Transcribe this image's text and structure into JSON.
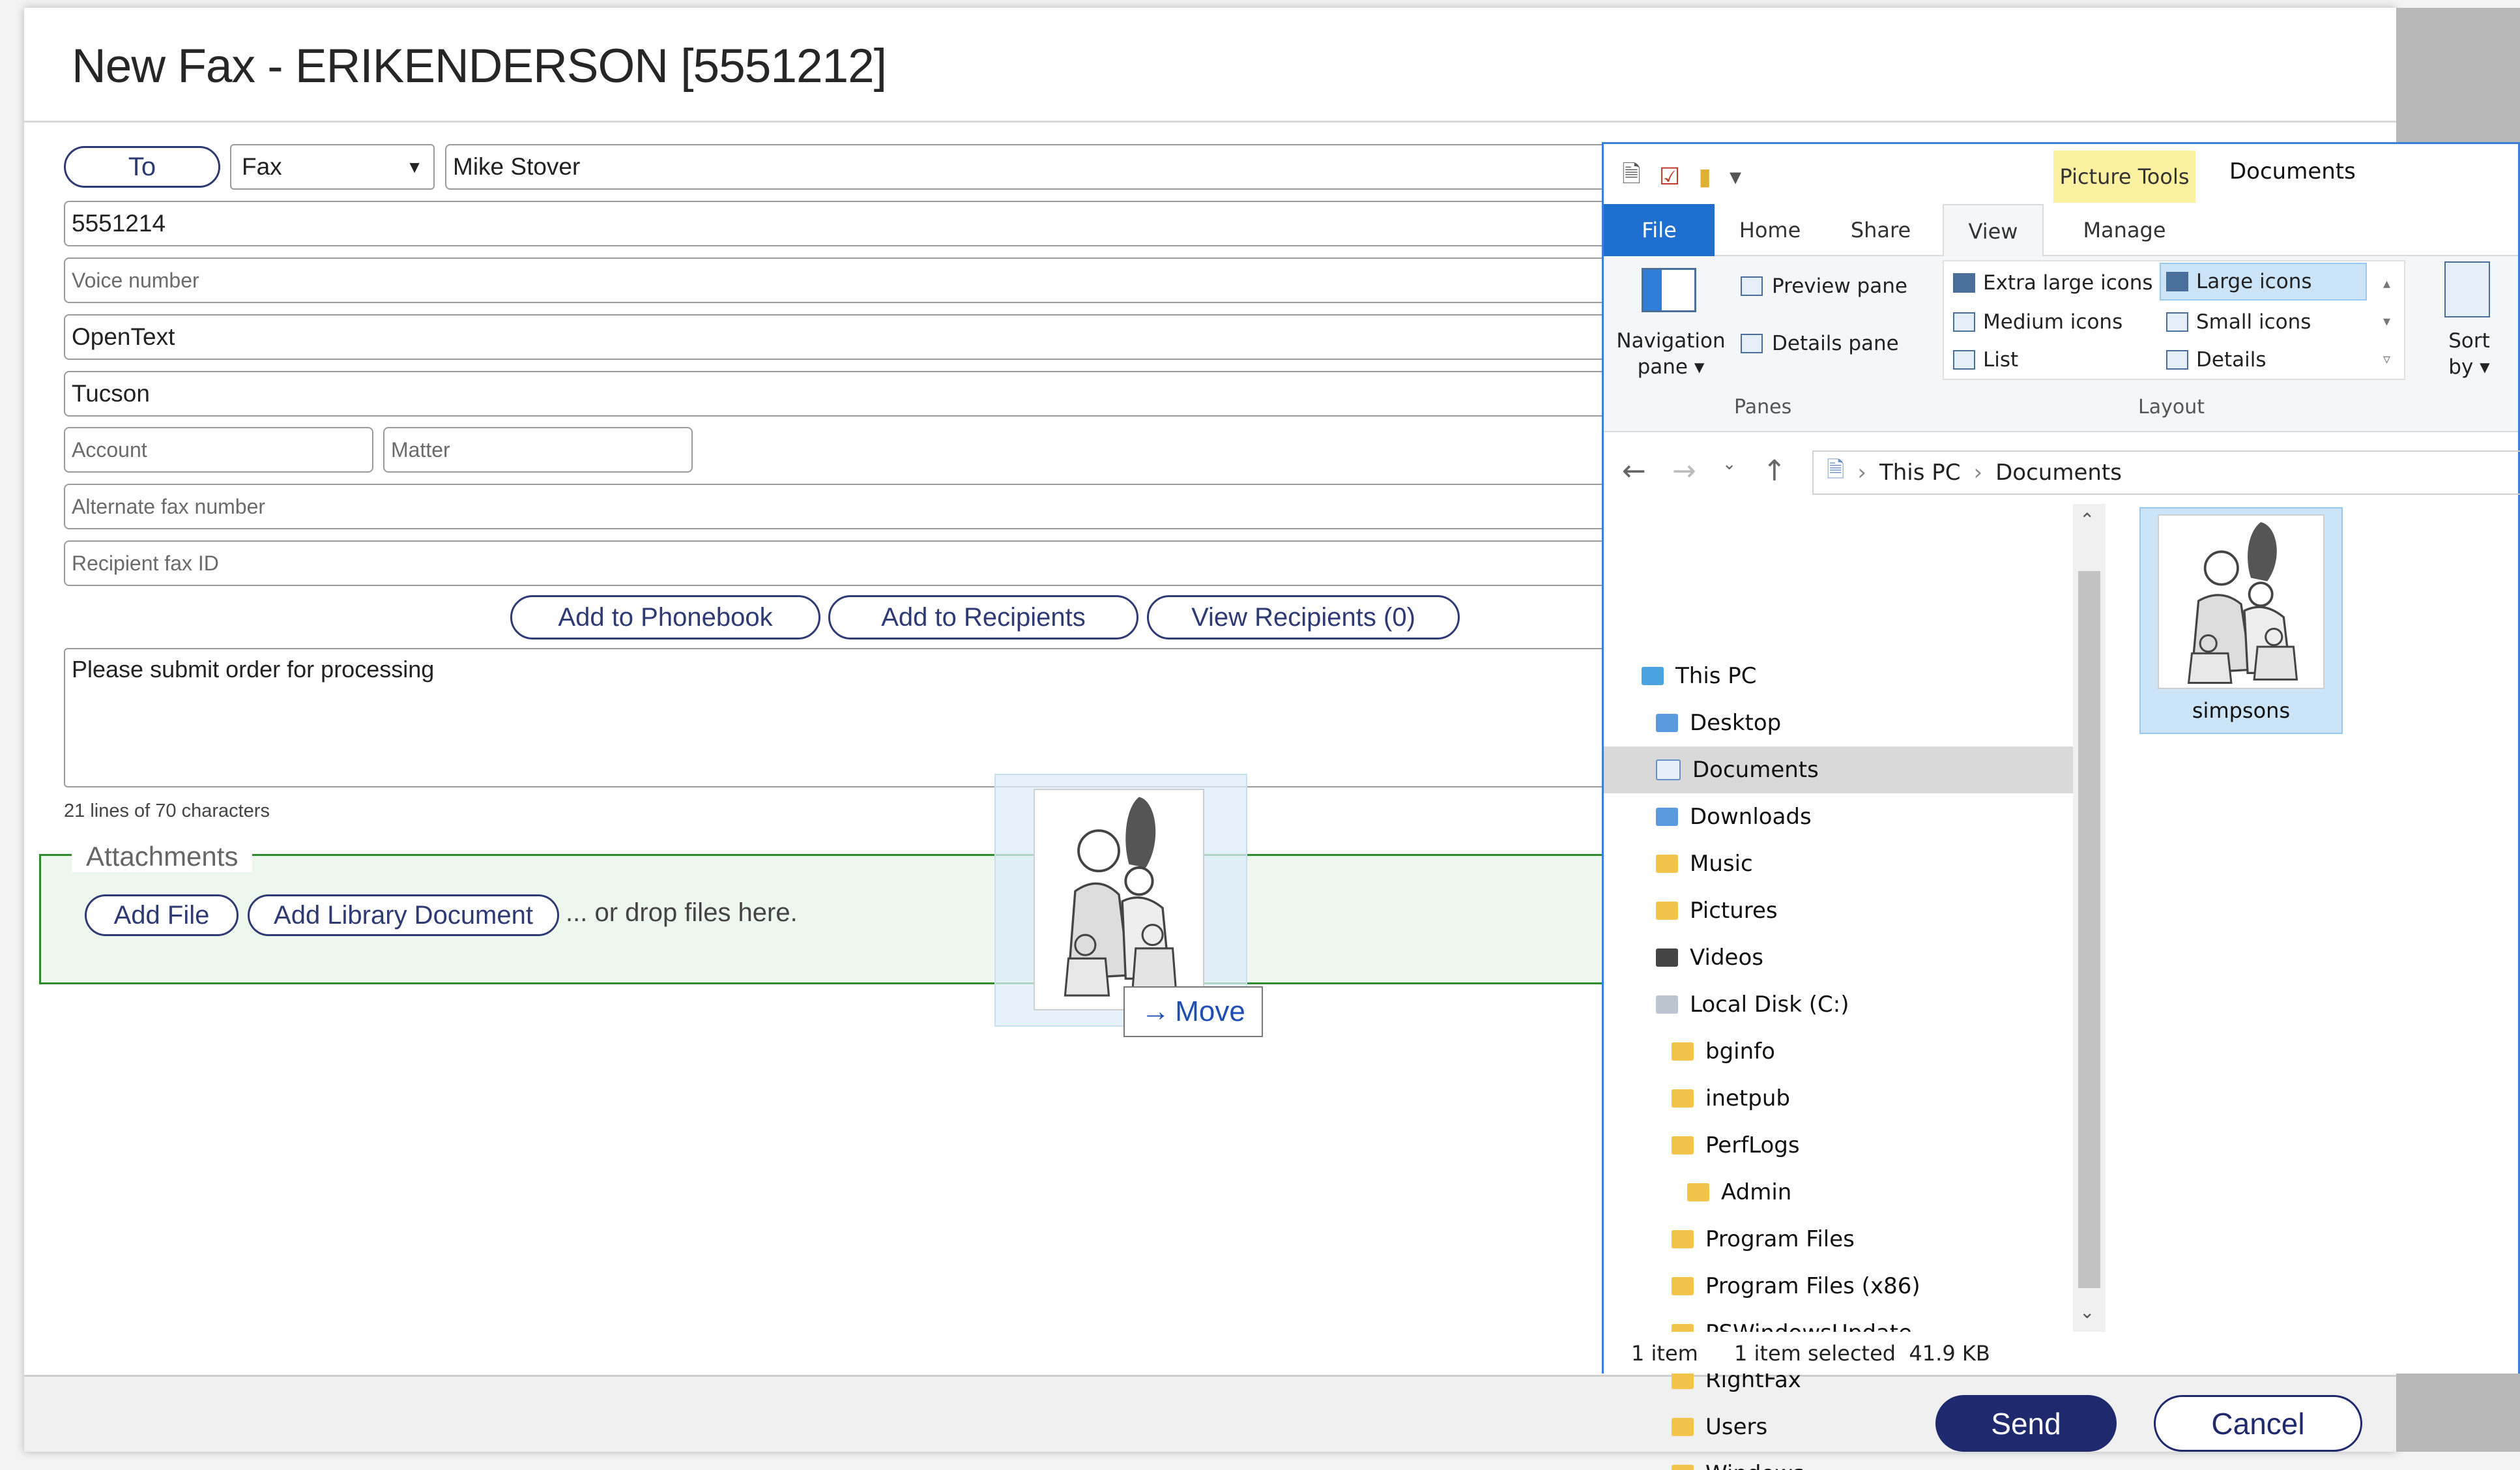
{
  "dialog": {
    "title": "New Fax - ERIKENDERSON [5551212]",
    "to_button": "To",
    "type_select": "Fax",
    "recipient_name": "Mike Stover",
    "fax_number": "5551214",
    "voice_placeholder": "Voice number",
    "company": "OpenText",
    "city": "Tucson",
    "account_placeholder": "Account",
    "matter_placeholder": "Matter",
    "alt_fax_placeholder": "Alternate fax number",
    "recipient_id_placeholder": "Recipient fax ID",
    "add_phonebook": "Add to Phonebook",
    "add_recipients": "Add to Recipients",
    "view_recipients": "View Recipients (0)",
    "message": "Please submit order for processing",
    "char_info": "21 lines of 70 characters",
    "attachments_legend": "Attachments",
    "add_file": "Add File",
    "add_library": "Add Library Document",
    "drop_text": "... or drop files here.",
    "send": "Send",
    "cancel": "Cancel",
    "move_tip": "Move"
  },
  "explorer": {
    "window_title": "Documents",
    "picture_tools": "Picture Tools",
    "tabs": {
      "file": "File",
      "home": "Home",
      "share": "Share",
      "view": "View",
      "manage": "Manage"
    },
    "ribbon": {
      "navigation_pane_1": "Navigation",
      "navigation_pane_2": "pane ▾",
      "preview_pane": "Preview pane",
      "details_pane": "Details pane",
      "panes_label": "Panes",
      "layout_label": "Layout",
      "extra_large": "Extra large icons",
      "large": "Large icons",
      "medium": "Medium icons",
      "small": "Small icons",
      "list": "List",
      "details": "Details",
      "sort_1": "Sort",
      "sort_2": "by ▾"
    },
    "address": {
      "this_pc": "This PC",
      "documents": "Documents"
    },
    "tree": [
      {
        "label": "This PC"
      },
      {
        "label": "Desktop"
      },
      {
        "label": "Documents"
      },
      {
        "label": "Downloads"
      },
      {
        "label": "Music"
      },
      {
        "label": "Pictures"
      },
      {
        "label": "Videos"
      },
      {
        "label": "Local Disk (C:)"
      },
      {
        "label": "bginfo"
      },
      {
        "label": "inetpub"
      },
      {
        "label": "PerfLogs"
      },
      {
        "label": "Admin"
      },
      {
        "label": "Program Files"
      },
      {
        "label": "Program Files (x86)"
      },
      {
        "label": "PSWindowsUpdate"
      },
      {
        "label": "RightFax"
      },
      {
        "label": "Users"
      },
      {
        "label": "Windows"
      }
    ],
    "file_name": "simpsons",
    "status_items": "1 item",
    "status_selected": "1 item selected  41.9 KB"
  }
}
